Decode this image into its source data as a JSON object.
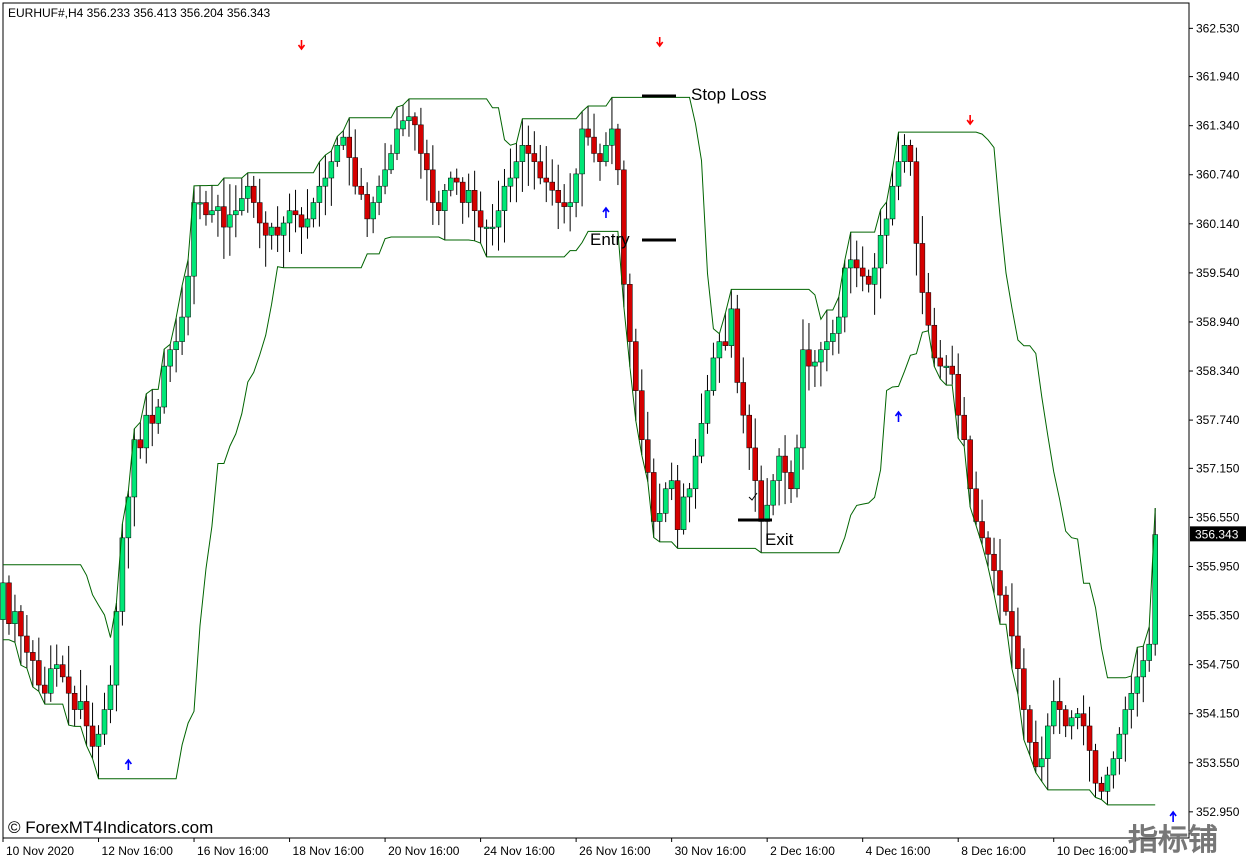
{
  "chart_data": {
    "type": "candlestick",
    "title": "EURHUF#,H4  356.233 356.413 356.204 356.343",
    "current_price": "356.343",
    "ylim": [
      352.63,
      362.84
    ],
    "y_ticks": [
      "362.530",
      "361.940",
      "361.340",
      "360.740",
      "360.140",
      "359.540",
      "358.940",
      "358.340",
      "357.740",
      "357.150",
      "356.550",
      "355.950",
      "355.350",
      "354.750",
      "354.150",
      "353.550",
      "352.950"
    ],
    "y_tick_values": [
      362.53,
      361.94,
      361.34,
      360.74,
      360.14,
      359.54,
      358.94,
      358.34,
      357.74,
      357.15,
      356.55,
      355.95,
      355.35,
      354.75,
      354.15,
      353.55,
      352.95
    ],
    "x_ticks": [
      "10 Nov 2020",
      "12 Nov 16:00",
      "16 Nov 16:00",
      "18 Nov 16:00",
      "20 Nov 16:00",
      "24 Nov 16:00",
      "26 Nov 16:00",
      "30 Nov 16:00",
      "2 Dec 16:00",
      "4 Dec 16:00",
      "8 Dec 16:00",
      "10 Dec 16:00"
    ],
    "x_tick_index": [
      0,
      16,
      32,
      48,
      64,
      80,
      96,
      112,
      128,
      144,
      160,
      176
    ],
    "candle_count": 198,
    "closes": [
      355.75,
      355.25,
      355.4,
      355.1,
      354.9,
      354.8,
      354.5,
      354.4,
      354.7,
      354.75,
      354.6,
      354.4,
      354.2,
      354.3,
      354.0,
      353.75,
      353.9,
      354.2,
      354.5,
      355.4,
      356.3,
      356.8,
      357.5,
      357.4,
      357.8,
      357.7,
      357.9,
      358.4,
      358.6,
      358.7,
      359.0,
      359.5,
      360.4,
      360.4,
      360.25,
      360.3,
      360.35,
      360.1,
      360.25,
      360.3,
      360.45,
      360.6,
      360.4,
      360.15,
      360.0,
      360.1,
      360.0,
      360.15,
      360.3,
      360.25,
      360.1,
      360.2,
      360.4,
      360.6,
      360.7,
      360.9,
      361.1,
      361.2,
      360.95,
      360.6,
      360.5,
      360.2,
      360.4,
      360.6,
      360.8,
      361.0,
      361.3,
      361.4,
      361.45,
      361.35,
      361.0,
      360.8,
      360.4,
      360.3,
      360.55,
      360.7,
      360.65,
      360.4,
      360.55,
      360.3,
      360.1,
      360.1,
      360.1,
      360.3,
      360.6,
      360.7,
      360.9,
      361.1,
      361.0,
      360.9,
      360.7,
      360.65,
      360.55,
      360.4,
      360.35,
      360.4,
      360.75,
      361.3,
      361.2,
      361.0,
      360.9,
      361.1,
      361.3,
      360.8,
      359.4,
      358.7,
      358.1,
      357.5,
      357.1,
      356.5,
      356.6,
      356.9,
      357.0,
      356.4,
      356.8,
      356.9,
      357.3,
      357.7,
      358.1,
      358.5,
      358.7,
      358.65,
      359.1,
      358.2,
      357.8,
      357.4,
      357.0,
      356.5,
      356.7,
      357.0,
      357.3,
      357.1,
      356.9,
      357.4,
      358.6,
      358.4,
      358.45,
      358.6,
      358.7,
      358.8,
      359.0,
      359.6,
      359.7,
      359.6,
      359.5,
      359.4,
      359.6,
      360.0,
      360.2,
      360.6,
      360.9,
      361.1,
      360.9,
      359.9,
      359.3,
      358.9,
      358.5,
      358.4,
      358.4,
      358.3,
      357.8,
      357.5,
      356.9,
      356.5,
      356.3,
      356.1,
      355.9,
      355.6,
      355.4,
      355.1,
      354.7,
      354.2,
      353.8,
      353.5,
      353.6,
      354.0,
      354.3,
      354.2,
      354.0,
      354.1,
      354.15,
      354.0,
      353.7,
      353.3,
      353.2,
      353.4,
      353.6,
      353.9,
      354.2,
      354.4,
      354.6,
      354.8,
      355.0,
      356.34
    ],
    "annotations": [
      "Stop Loss",
      "Entry",
      "Exit"
    ],
    "line_color": "#006400",
    "bull_color": "#00e676",
    "bear_color": "#d50000"
  },
  "watermark": "© ForexMT4Indicators.com",
  "corner_text": "指标铺"
}
